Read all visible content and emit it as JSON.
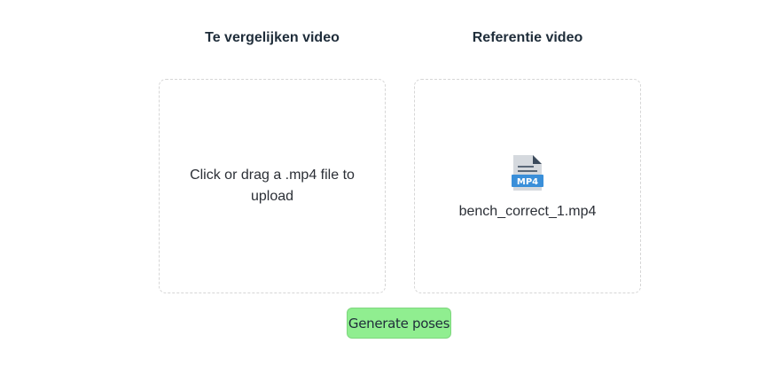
{
  "upload_left": {
    "title": "Te vergelijken video",
    "prompt": "Click or drag a .mp4 file to upload"
  },
  "upload_right": {
    "title": "Referentie video",
    "file_icon_label": "MP4",
    "file_icon": "mp4-file-icon",
    "file_name": "bench_correct_1.mp4"
  },
  "actions": {
    "generate_label": "Generate poses",
    "generate_color": "#90ee90"
  }
}
